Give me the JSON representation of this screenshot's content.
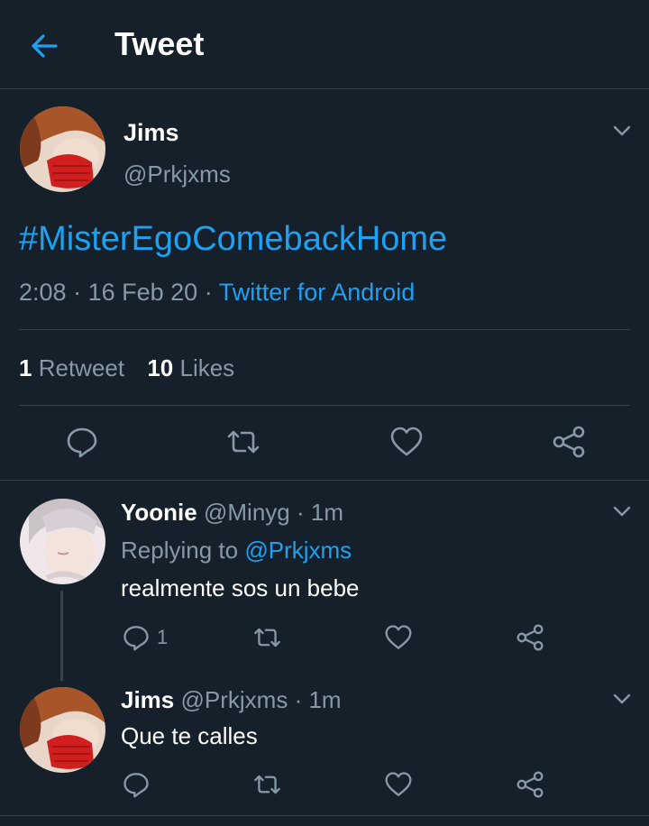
{
  "header": {
    "title": "Tweet",
    "back_icon": "arrow-left-icon"
  },
  "colors": {
    "background": "#15202b",
    "accent": "#1da1f2",
    "muted": "#8899a6",
    "divider": "#38444d"
  },
  "main_tweet": {
    "name": "Jims",
    "handle": "@Prkjxms",
    "text": "#MisterEgoComebackHome",
    "time": "2:08",
    "date": "16 Feb 20",
    "source": "Twitter for Android",
    "retweets_count": "1",
    "retweets_label": "Retweet",
    "likes_count": "10",
    "likes_label": "Likes"
  },
  "replies": [
    {
      "name": "Yoonie",
      "handle": "@Minyg",
      "time": "1m",
      "replying_prefix": "Replying to",
      "replying_to": "@Prkjxms",
      "text": "realmente sos un bebe",
      "reply_count": "1"
    },
    {
      "name": "Jims",
      "handle": "@Prkjxms",
      "time": "1m",
      "text": "Que te calles"
    }
  ],
  "separator": "·"
}
